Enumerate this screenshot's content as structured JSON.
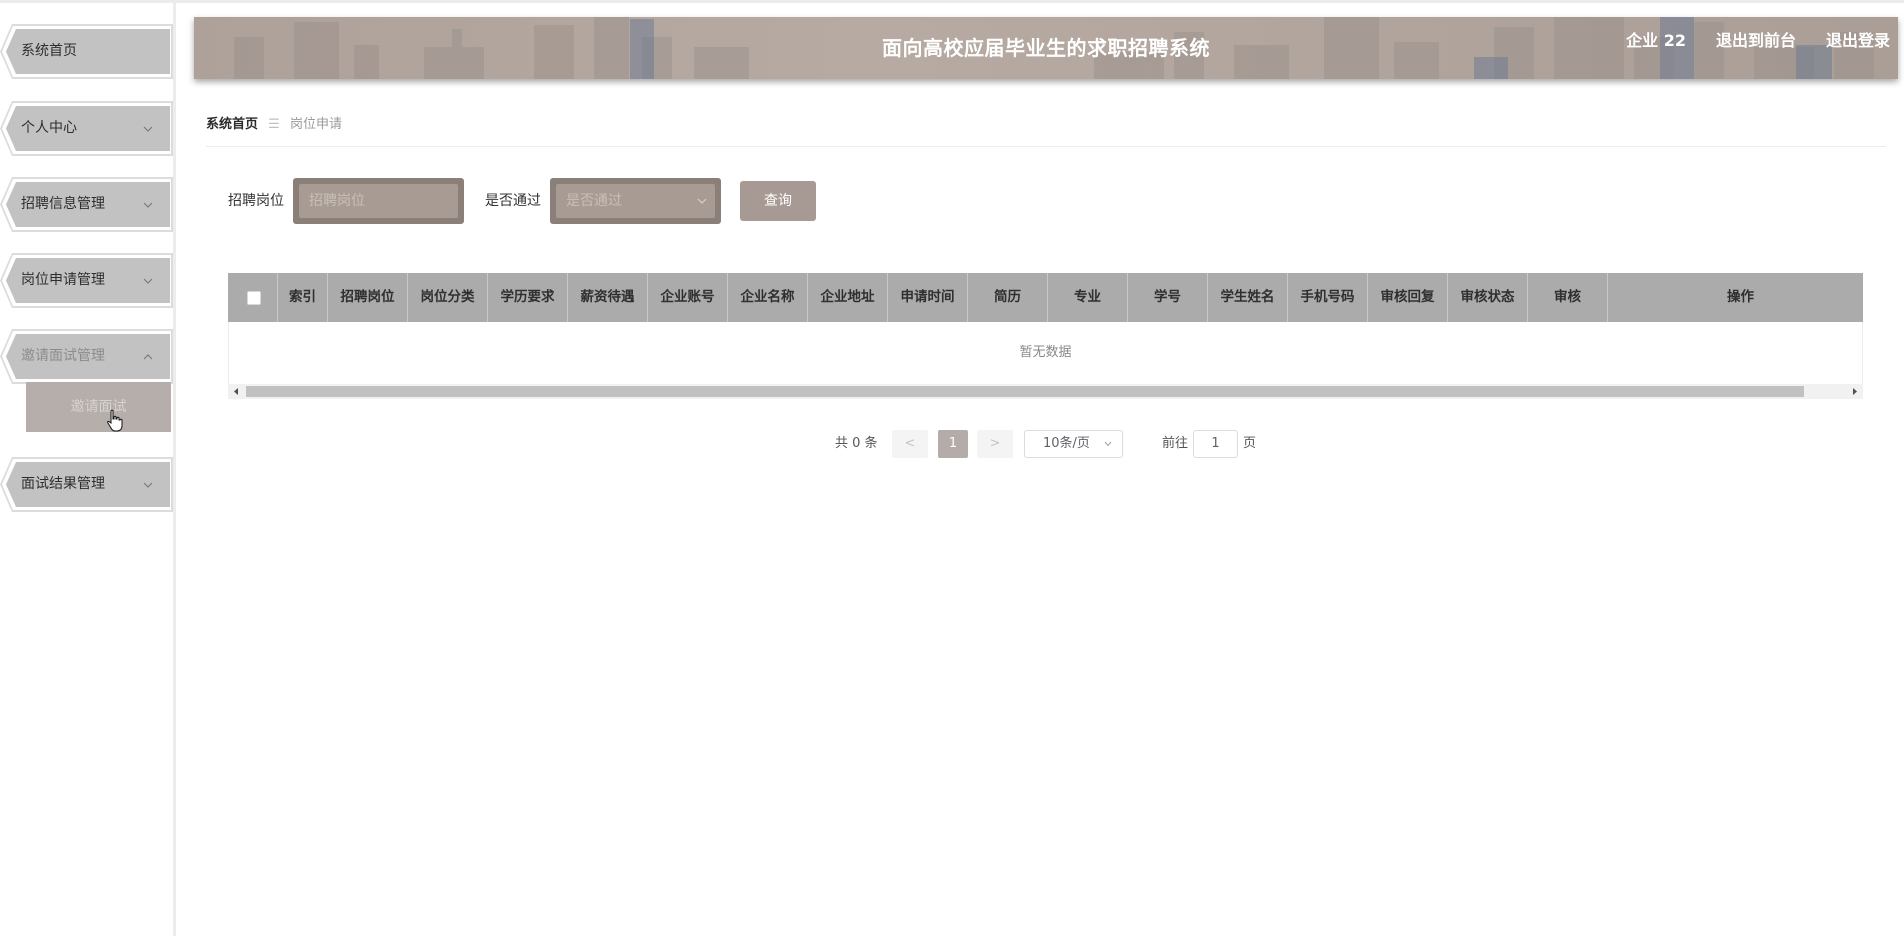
{
  "sidebar": {
    "items": [
      {
        "label": "系统首页",
        "has_chevron": false
      },
      {
        "label": "个人中心",
        "has_chevron": true
      },
      {
        "label": "招聘信息管理",
        "has_chevron": true
      },
      {
        "label": "岗位申请管理",
        "has_chevron": true
      },
      {
        "label": "邀请面试管理",
        "has_chevron": true,
        "expanded": true
      },
      {
        "label": "面试结果管理",
        "has_chevron": true
      }
    ],
    "submenu": {
      "label": "邀请面试"
    }
  },
  "header": {
    "title": "面向高校应届毕业生的求职招聘系统",
    "user": "企业 22",
    "back_to_front": "退出到前台",
    "logout": "退出登录"
  },
  "breadcrumb": {
    "home": "系统首页",
    "separator": "☰",
    "current": "岗位申请"
  },
  "search": {
    "position_label": "招聘岗位",
    "position_placeholder": "招聘岗位",
    "approved_label": "是否通过",
    "approved_placeholder": "是否通过",
    "query_button": "查询"
  },
  "table": {
    "columns": [
      "索引",
      "招聘岗位",
      "岗位分类",
      "学历要求",
      "薪资待遇",
      "企业账号",
      "企业名称",
      "企业地址",
      "申请时间",
      "简历",
      "专业",
      "学号",
      "学生姓名",
      "手机号码",
      "审核回复",
      "审核状态",
      "审核",
      "操作"
    ],
    "empty_text": "暂无数据"
  },
  "pagination": {
    "total_text": "共 0 条",
    "prev": "<",
    "current_page": "1",
    "next": ">",
    "page_size": "10条/页",
    "goto_label": "前往",
    "goto_value": "1",
    "page_suffix": "页"
  },
  "colors": {
    "banner": "#b0a49d",
    "sidebar_button": "#c2c2c2",
    "submenu_active": "#b5aeab",
    "search_box": "#8b7f79",
    "table_header": "#ababab",
    "query_button": "#a79994"
  },
  "icons": [
    "chevron-down-icon",
    "chevron-up-icon",
    "hand-cursor-icon",
    "checkbox-icon",
    "caret-down-icon",
    "scroll-left-icon",
    "scroll-right-icon"
  ]
}
